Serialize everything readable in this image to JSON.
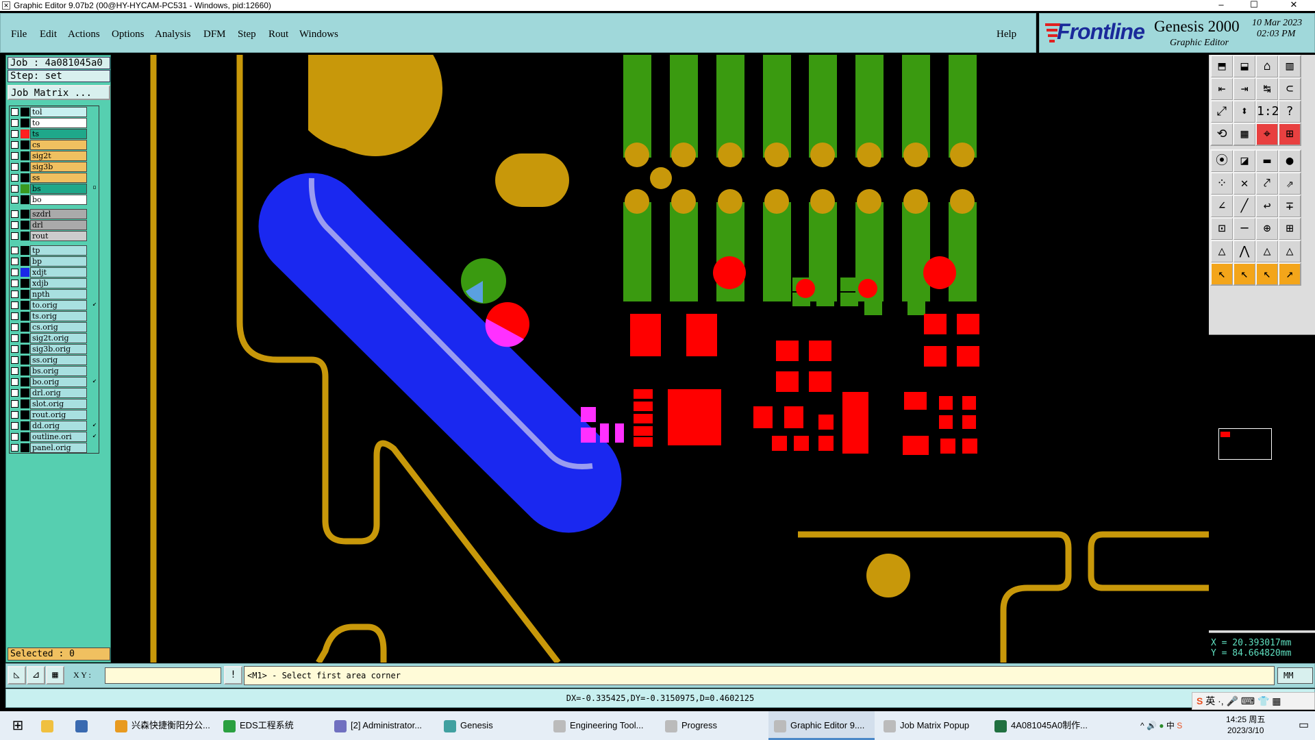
{
  "window": {
    "title": "Graphic Editor 9.07b2 (00@HY-HYCAM-PC531 - Windows, pid:12660)"
  },
  "menu": {
    "items": [
      "File",
      "Edit",
      "Actions",
      "Options",
      "Analysis",
      "DFM",
      "Step",
      "Rout",
      "Windows"
    ],
    "help": "Help"
  },
  "brand": {
    "name": "Frontline",
    "product": "Genesis 2000",
    "subtitle": "Graphic Editor",
    "date": "10 Mar 2023",
    "time": "02:03 PM"
  },
  "job": {
    "job_label": "Job : 4a081045a0",
    "step_label": "Step: set",
    "matrix_button": "Job Matrix ..."
  },
  "layers": [
    {
      "name": "tol",
      "color": "#a8e0e0",
      "bg": "#c8f0f0"
    },
    {
      "name": "to",
      "color": "#ffffff",
      "bg": "#ffffff"
    },
    {
      "name": "ts",
      "color": "#ff2020",
      "bg": "#1fa88a"
    },
    {
      "name": "cs",
      "color": "#f0c060",
      "bg": "#f0c060"
    },
    {
      "name": "sig2t",
      "color": "#f0c060",
      "bg": "#f0c060"
    },
    {
      "name": "sig3b",
      "color": "#f0c060",
      "bg": "#f0c060"
    },
    {
      "name": "ss",
      "color": "#f0c060",
      "bg": "#f0c060"
    },
    {
      "name": "bs",
      "color": "#3a9a20",
      "bg": "#1fa88a",
      "mark": "▫"
    },
    {
      "name": "bo",
      "color": "#ffffff",
      "bg": "#ffffff"
    },
    {
      "name": "szdrl",
      "color": "#aaaaaa",
      "bg": "#aaaaaa"
    },
    {
      "name": "drl",
      "color": "#aaaaaa",
      "bg": "#aaaaaa"
    },
    {
      "name": "rout",
      "color": "#cccccc",
      "bg": "#cccccc"
    },
    {
      "name": "tp",
      "color": "#a8e0e0",
      "bg": "#a8e0e0"
    },
    {
      "name": "bp",
      "color": "#a8e0e0",
      "bg": "#a8e0e0"
    },
    {
      "name": "xdjt",
      "color": "#1a28e8",
      "bg": "#a8e0e0"
    },
    {
      "name": "xdjb",
      "color": "#a8e0e0",
      "bg": "#a8e0e0"
    },
    {
      "name": "npth",
      "color": "#a8e0e0",
      "bg": "#a8e0e0"
    },
    {
      "name": "to.orig",
      "color": "#a8e0e0",
      "bg": "#a8e0e0",
      "mark": "↙"
    },
    {
      "name": "ts.orig",
      "color": "#a8e0e0",
      "bg": "#a8e0e0"
    },
    {
      "name": "cs.orig",
      "color": "#a8e0e0",
      "bg": "#a8e0e0"
    },
    {
      "name": "sig2t.orig",
      "color": "#a8e0e0",
      "bg": "#a8e0e0"
    },
    {
      "name": "sig3b.orig",
      "color": "#a8e0e0",
      "bg": "#a8e0e0"
    },
    {
      "name": "ss.orig",
      "color": "#a8e0e0",
      "bg": "#a8e0e0"
    },
    {
      "name": "bs.orig",
      "color": "#a8e0e0",
      "bg": "#a8e0e0"
    },
    {
      "name": "bo.orig",
      "color": "#a8e0e0",
      "bg": "#a8e0e0",
      "mark": "↙"
    },
    {
      "name": "drl.orig",
      "color": "#a8e0e0",
      "bg": "#a8e0e0"
    },
    {
      "name": "slot.orig",
      "color": "#a8e0e0",
      "bg": "#a8e0e0"
    },
    {
      "name": "rout.orig",
      "color": "#a8e0e0",
      "bg": "#a8e0e0"
    },
    {
      "name": "dd.orig",
      "color": "#a8e0e0",
      "bg": "#a8e0e0",
      "mark": "↙"
    },
    {
      "name": "outline.ori",
      "color": "#a8e0e0",
      "bg": "#a8e0e0",
      "mark": "↙"
    },
    {
      "name": "panel.orig",
      "color": "#a8e0e0",
      "bg": "#a8e0e0"
    }
  ],
  "selected": "Selected : 0",
  "coords": {
    "x": "X = 20.393017mm",
    "y": "Y = 84.664820mm"
  },
  "command": {
    "xy_label": "X Y :",
    "xy_value": "",
    "prompt": "<M1> - Select first area corner",
    "units": "MM"
  },
  "status": "DX=-0.335425,DY=-0.3150975,D=0.4602125",
  "taskbar": {
    "items": [
      {
        "label": "兴森快捷衡阳分公...",
        "icon": "app-icon",
        "color": "#e89a20"
      },
      {
        "label": "EDS工程系统",
        "icon": "f-app-icon",
        "color": "#2aa040"
      },
      {
        "label": "[2] Administrator...",
        "icon": "save-icon",
        "color": "#7070c0"
      },
      {
        "label": "Genesis",
        "icon": "genesis-icon",
        "color": "#40a0a0"
      },
      {
        "label": "Engineering Tool...",
        "icon": "x-window-icon",
        "color": "#bbbbbb"
      },
      {
        "label": "Progress",
        "icon": "x-window-icon",
        "color": "#bbbbbb"
      },
      {
        "label": "Graphic Editor 9....",
        "icon": "x-window-icon",
        "color": "#bbbbbb"
      },
      {
        "label": "Job Matrix Popup",
        "icon": "x-window-icon",
        "color": "#bbbbbb"
      },
      {
        "label": "4A081045A0制作...",
        "icon": "excel-icon",
        "color": "#207040"
      }
    ],
    "ime": "英",
    "lang": "中",
    "time": "14:25 周五",
    "date": "2023/3/10"
  },
  "colors": {
    "trace": "#c8980a",
    "pad_green": "#3a9a10",
    "pad_red": "#ff0000",
    "blue": "#1a28f0",
    "magenta": "#ff30ff"
  }
}
